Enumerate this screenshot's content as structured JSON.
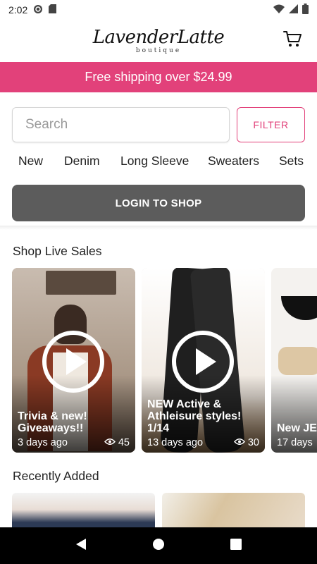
{
  "status_bar": {
    "time": "2:02",
    "icons": [
      "sync-icon",
      "sd-card-icon",
      "wifi-icon",
      "signal-icon",
      "battery-icon"
    ]
  },
  "header": {
    "logo_main": "LavenderLatte",
    "logo_sub": "boutique",
    "cart_icon": "shopping-cart-icon"
  },
  "promo": {
    "text": "Free shipping over $24.99",
    "color": "#e2417a"
  },
  "search": {
    "placeholder": "Search",
    "value": ""
  },
  "filter": {
    "label": "FILTER"
  },
  "categories": [
    "New",
    "Denim",
    "Long Sleeve",
    "Sweaters",
    "Sets"
  ],
  "login": {
    "label": "LOGIN TO SHOP"
  },
  "live_sales": {
    "title": "Shop Live Sales",
    "cards": [
      {
        "title": "Trivia & new! Giveaways!!",
        "age": "3 days ago",
        "views": "45"
      },
      {
        "title": "NEW Active & Athleisure styles! 1/14",
        "age": "13 days ago",
        "views": "30"
      },
      {
        "title": "New JE intimat",
        "age": "17 days",
        "views": ""
      }
    ]
  },
  "recent": {
    "title": "Recently Added"
  },
  "nav": {
    "back_icon": "back-icon",
    "home_icon": "home-icon",
    "recents_icon": "recents-icon"
  },
  "colors": {
    "accent": "#e2417a",
    "login_bg": "#5c5c5c"
  }
}
